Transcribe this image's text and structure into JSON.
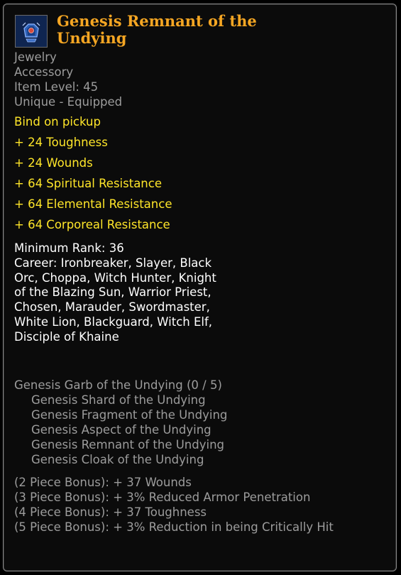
{
  "item": {
    "name": "Genesis Remnant of the Undying",
    "icon": "blue-jewelry-icon",
    "type": "Jewelry",
    "slot": "Accessory",
    "item_level": "Item Level: 45",
    "rarity": "Unique - Equipped",
    "bind": "Bind on pickup"
  },
  "stats": [
    "+ 24 Toughness",
    "+ 24 Wounds",
    "+ 64 Spiritual Resistance",
    "+ 64 Elemental Resistance",
    "+ 64 Corporeal Resistance"
  ],
  "requirements": {
    "min_rank": "Minimum Rank: 36",
    "career": "Career: Ironbreaker, Slayer, Black Orc, Choppa, Witch Hunter, Knight of the Blazing Sun, Warrior Priest, Chosen, Marauder, Swordmaster, White Lion, Blackguard, Witch Elf, Disciple of Khaine"
  },
  "set": {
    "title": "Genesis Garb of the Undying (0 / 5)",
    "pieces": [
      "Genesis Shard of the Undying",
      "Genesis Fragment of the Undying",
      "Genesis Aspect of the Undying",
      "Genesis Remnant of the Undying",
      "Genesis Cloak of the Undying"
    ],
    "bonuses": [
      "(2 Piece Bonus): + 37 Wounds",
      "(3 Piece Bonus): + 3% Reduced Armor Penetration",
      "(4 Piece Bonus): + 37 Toughness",
      "(5 Piece Bonus): + 3% Reduction in being Critically Hit"
    ]
  },
  "colors": {
    "title": "#f5a623",
    "stat": "#ffe629",
    "info": "#9c9c9c",
    "text": "#ffffff",
    "background": "#0b0b0b",
    "border": "#8a8a8a"
  }
}
